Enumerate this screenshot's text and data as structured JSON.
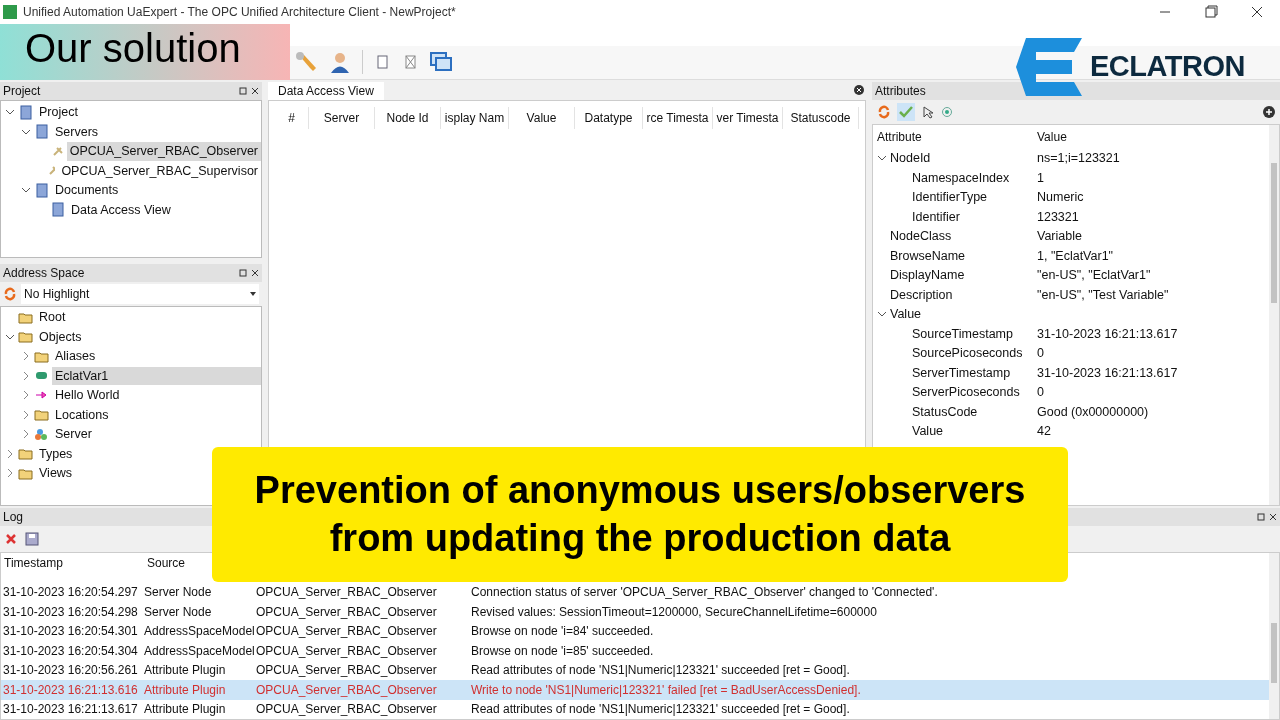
{
  "window": {
    "title": "Unified Automation UaExpert - The OPC Unified Architecture Client - NewProject*"
  },
  "overlay_label": {
    "text": "Our solution"
  },
  "brand": {
    "name": "ECLATRON"
  },
  "project_panel": {
    "title": "Project",
    "tree": [
      {
        "label": "Project",
        "kind": "project",
        "expanded": true,
        "selected": false,
        "children": [
          {
            "label": "Servers",
            "kind": "servers",
            "expanded": true,
            "selected": false,
            "children": [
              {
                "label": "OPCUA_Server_RBAC_Observer",
                "kind": "server",
                "selected": true
              },
              {
                "label": "OPCUA_Server_RBAC_Supervisor",
                "kind": "server",
                "selected": false
              }
            ]
          },
          {
            "label": "Documents",
            "kind": "servers",
            "expanded": true,
            "selected": false,
            "children": [
              {
                "label": "Data Access View",
                "kind": "document",
                "selected": false
              }
            ]
          }
        ]
      }
    ]
  },
  "address_panel": {
    "title": "Address Space",
    "filter": "No Highlight",
    "tree": [
      {
        "label": "Root",
        "kind": "folder",
        "selected": false
      },
      {
        "label": "Objects",
        "kind": "folder",
        "expanded": true,
        "selected": false,
        "children": [
          {
            "label": "Aliases",
            "kind": "folder",
            "expanded": false,
            "selected": false
          },
          {
            "label": "EclatVar1",
            "kind": "variable",
            "expanded": false,
            "selected": true
          },
          {
            "label": "Hello World",
            "kind": "method",
            "expanded": false,
            "selected": false
          },
          {
            "label": "Locations",
            "kind": "folder",
            "expanded": false,
            "selected": false
          },
          {
            "label": "Server",
            "kind": "object",
            "expanded": false,
            "selected": false
          }
        ]
      },
      {
        "label": "Types",
        "kind": "folder",
        "expanded": false,
        "selected": false
      },
      {
        "label": "Views",
        "kind": "folder",
        "expanded": false,
        "selected": false
      }
    ]
  },
  "data_access_view": {
    "tab": "Data Access View",
    "columns": [
      "#",
      "Server",
      "Node Id",
      "isplay Nam",
      "Value",
      "Datatype",
      "rce Timesta",
      "ver Timesta",
      "Statuscode"
    ]
  },
  "attributes_panel": {
    "title": "Attributes",
    "columns": [
      "Attribute",
      "Value"
    ],
    "rows": [
      {
        "name": "NodeId",
        "value": "ns=1;i=123321",
        "expanded": true,
        "children": [
          {
            "name": "NamespaceIndex",
            "value": "1"
          },
          {
            "name": "IdentifierType",
            "value": "Numeric"
          },
          {
            "name": "Identifier",
            "value": "123321"
          }
        ]
      },
      {
        "name": "NodeClass",
        "value": "Variable"
      },
      {
        "name": "BrowseName",
        "value": "1, \"EclatVar1\""
      },
      {
        "name": "DisplayName",
        "value": "\"en-US\", \"EclatVar1\""
      },
      {
        "name": "Description",
        "value": "\"en-US\", \"Test Variable\""
      },
      {
        "name": "Value",
        "value": "",
        "expanded": true,
        "children": [
          {
            "name": "SourceTimestamp",
            "value": "31-10-2023 16:21:13.617"
          },
          {
            "name": "SourcePicoseconds",
            "value": "0"
          },
          {
            "name": "ServerTimestamp",
            "value": "31-10-2023 16:21:13.617"
          },
          {
            "name": "ServerPicoseconds",
            "value": "0"
          },
          {
            "name": "StatusCode",
            "value": "Good (0x00000000)"
          },
          {
            "name": "Value",
            "value": "42"
          }
        ]
      }
    ]
  },
  "log_panel": {
    "title": "Log",
    "columns": [
      "Timestamp",
      "Source"
    ],
    "rows": [
      {
        "timestamp": "31-10-2023 16:20:54.297",
        "source": "Server Node",
        "server": "OPCUA_Server_RBAC_Observer",
        "message": "Connection status of server 'OPCUA_Server_RBAC_Observer' changed to 'Connected'.",
        "kind": "info",
        "selected": false
      },
      {
        "timestamp": "31-10-2023 16:20:54.298",
        "source": "Server Node",
        "server": "OPCUA_Server_RBAC_Observer",
        "message": "Revised values: SessionTimeout=1200000, SecureChannelLifetime=600000",
        "kind": "info",
        "selected": false
      },
      {
        "timestamp": "31-10-2023 16:20:54.301",
        "source": "AddressSpaceModel",
        "server": "OPCUA_Server_RBAC_Observer",
        "message": "Browse on node 'i=84' succeeded.",
        "kind": "info",
        "selected": false
      },
      {
        "timestamp": "31-10-2023 16:20:54.304",
        "source": "AddressSpaceModel",
        "server": "OPCUA_Server_RBAC_Observer",
        "message": "Browse on node 'i=85' succeeded.",
        "kind": "info",
        "selected": false
      },
      {
        "timestamp": "31-10-2023 16:20:56.261",
        "source": "Attribute Plugin",
        "server": "OPCUA_Server_RBAC_Observer",
        "message": "Read attributes of node 'NS1|Numeric|123321' succeeded [ret = Good].",
        "kind": "info",
        "selected": false
      },
      {
        "timestamp": "31-10-2023 16:21:13.616",
        "source": "Attribute Plugin",
        "server": "OPCUA_Server_RBAC_Observer",
        "message": "Write to node 'NS1|Numeric|123321' failed [ret = BadUserAccessDenied].",
        "kind": "error",
        "selected": true
      },
      {
        "timestamp": "31-10-2023 16:21:13.617",
        "source": "Attribute Plugin",
        "server": "OPCUA_Server_RBAC_Observer",
        "message": "Read attributes of node 'NS1|Numeric|123321' succeeded [ret = Good].",
        "kind": "info",
        "selected": false
      }
    ]
  },
  "caption": {
    "lines": [
      "Prevention of anonymous users/observers",
      "from updating the production data"
    ]
  }
}
